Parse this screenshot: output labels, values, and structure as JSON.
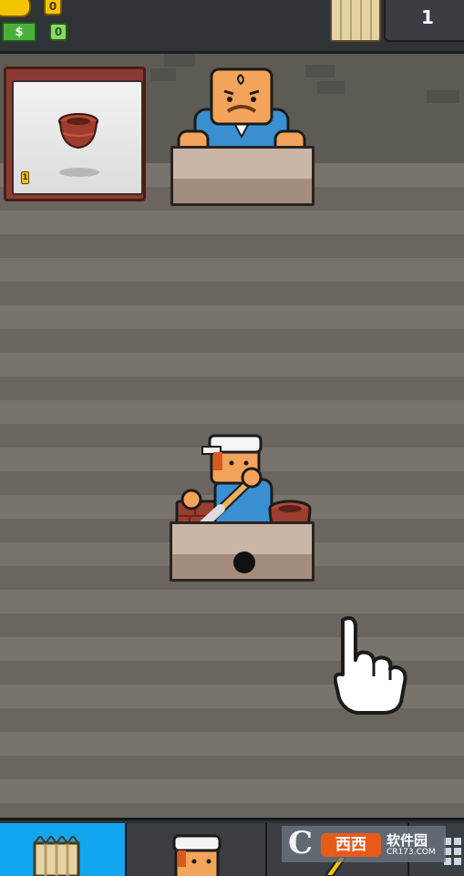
{
  "hud": {
    "coins": "0",
    "cash_symbol": "$",
    "cash": "0",
    "crates_count": "1"
  },
  "order": {
    "item_icon": "clay-pot-icon",
    "quantity": "1"
  },
  "customer": {
    "icon": "worried-customer-icon"
  },
  "worker": {
    "icon": "potter-worker-icon"
  },
  "hint": {
    "icon": "tap-hand-icon"
  },
  "tabs": [
    {
      "icon": "crates-tab-icon",
      "active": true
    },
    {
      "icon": "worker-tab-icon",
      "active": false
    },
    {
      "icon": "upgrade-tab-icon",
      "active": false
    },
    {
      "icon": "grid-tab-icon",
      "active": false
    }
  ],
  "watermark": {
    "c_letter": "C",
    "xixi": "西西",
    "site_name": "软件园",
    "url": "CR173.COM"
  },
  "colors": {
    "active_tab": "#12a6f0",
    "coin": "#f5c400",
    "cash": "#4caf3c",
    "brick": "#8a3c34"
  }
}
